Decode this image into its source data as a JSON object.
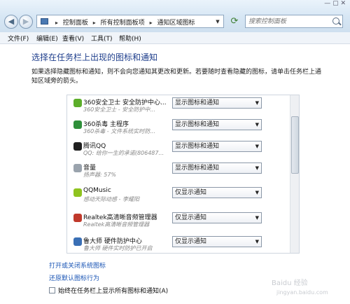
{
  "address": {
    "crumbs": [
      "控制面板",
      "所有控制面板项",
      "通知区域图标"
    ],
    "separator": "▸"
  },
  "search": {
    "placeholder": "搜索控制面板"
  },
  "window_controls": "— ▢ ✕",
  "menu": [
    {
      "label": "文件(F)"
    },
    {
      "label": "编辑(E)"
    },
    {
      "label": "查看(V)"
    },
    {
      "label": "工具(T)"
    },
    {
      "label": "帮助(H)"
    }
  ],
  "page": {
    "title": "选择在任务栏上出现的图标和通知",
    "description": "如果选择隐藏图标和通知，则不会向您通知其更改和更新。若要随时查看隐藏的图标，请单击任务栏上通知区域旁的箭头。"
  },
  "table": {
    "rows": [
      {
        "name": "360安全卫士 安全防护中心...",
        "sub": "360安全卫士 - 安全防护中...",
        "value": "显示图标和通知",
        "icon_color": "#5cae2a"
      },
      {
        "name": "360杀毒 主程序",
        "sub": "360杀毒 - 文件系统实时防...",
        "value": "显示图标和通知",
        "icon_color": "#2f8f3a"
      },
      {
        "name": "腾讯QQ",
        "sub": "QQ: 给你一生的承诺(806487...",
        "value": "显示图标和通知",
        "icon_color": "#1f1f1f"
      },
      {
        "name": "音量",
        "sub": "扬声器: 57%",
        "value": "显示图标和通知",
        "icon_color": "#9aa3ad"
      },
      {
        "name": "QQMusic",
        "sub": "感动天际动感 - 李耀阳",
        "value": "仅显示通知",
        "icon_color": "#8fc31f"
      },
      {
        "name": "Realtek高清晰音频管理器",
        "sub": "Realtek高清晰音频管理器",
        "value": "仅显示通知",
        "icon_color": "#c0392b"
      },
      {
        "name": "鲁大师 硬件防护中心",
        "sub": "鲁大师 硬件实时防护已开启",
        "value": "仅显示通知",
        "icon_color": "#3a6fb5"
      }
    ]
  },
  "links": {
    "toggle_system_icons": "打开或关闭系统图标",
    "restore_defaults": "还原默认图标行为"
  },
  "always_show": {
    "label": "始终在任务栏上显示所有图标和通知(A)",
    "checked": false
  },
  "watermark": {
    "main": "Baidu 经验",
    "sub": "jingyan.baidu.com"
  }
}
